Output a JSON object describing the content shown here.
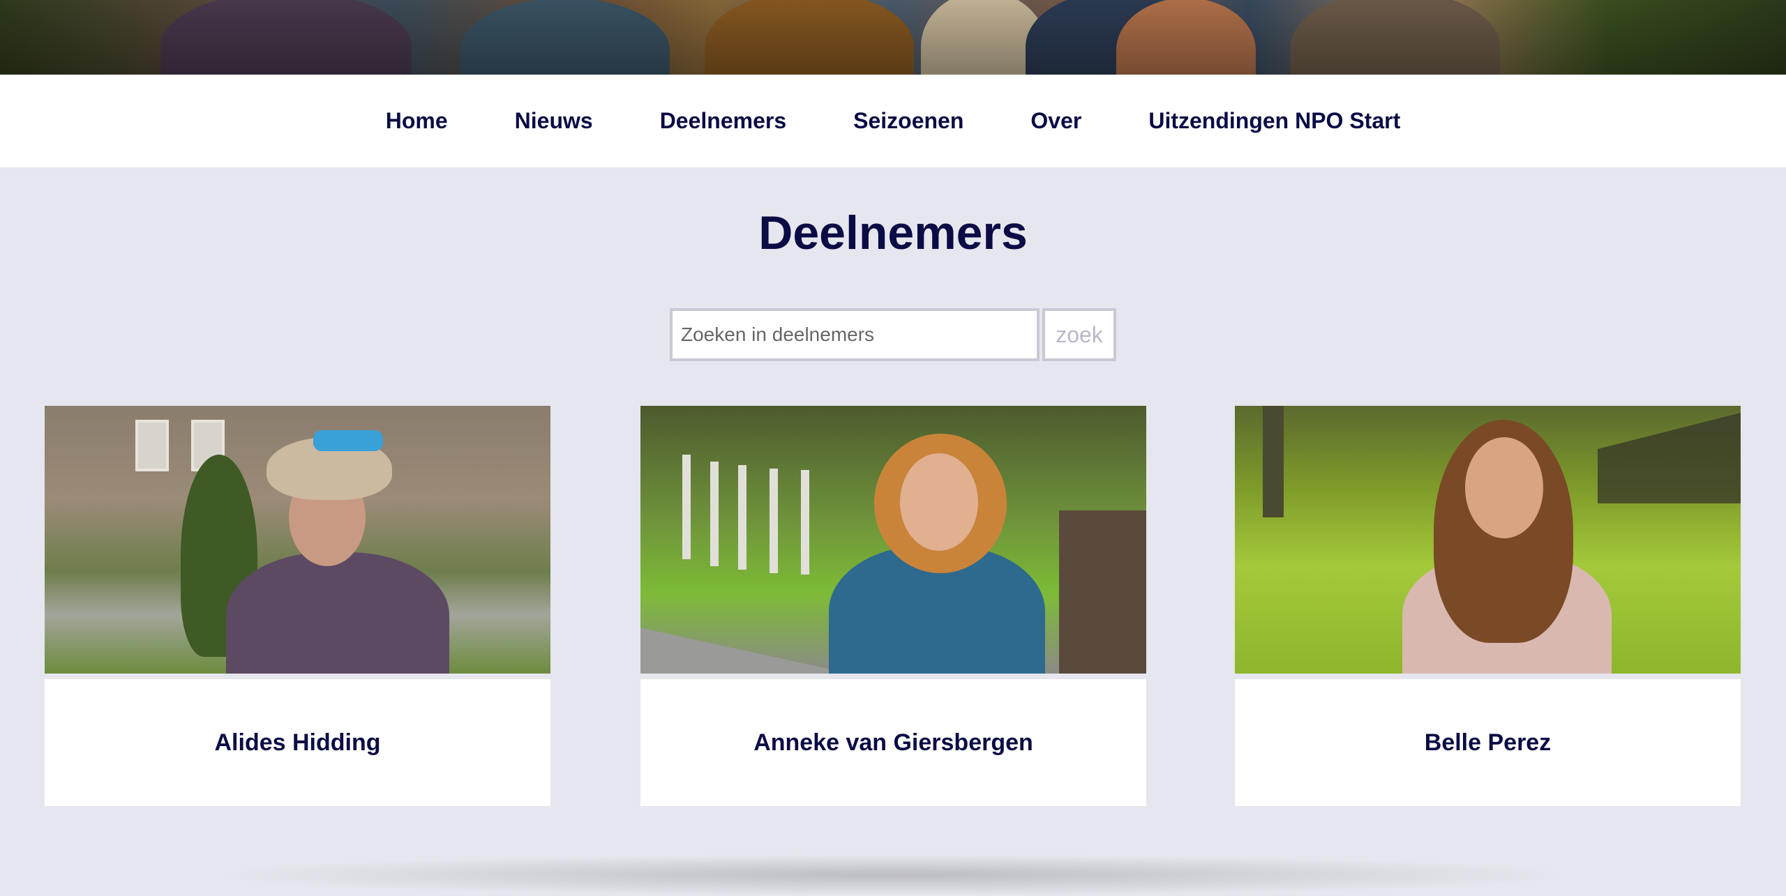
{
  "nav": {
    "items": [
      {
        "label": "Home"
      },
      {
        "label": "Nieuws"
      },
      {
        "label": "Deelnemers"
      },
      {
        "label": "Seizoenen"
      },
      {
        "label": "Over"
      },
      {
        "label": "Uitzendingen NPO Start"
      }
    ]
  },
  "page": {
    "title": "Deelnemers"
  },
  "search": {
    "placeholder": "Zoeken in deelnemers",
    "value": "",
    "button_label": "zoek"
  },
  "participants": [
    {
      "name": "Alides Hidding"
    },
    {
      "name": "Anneke van Giersbergen"
    },
    {
      "name": "Belle Perez"
    }
  ],
  "colors": {
    "primary_text": "#0b0b45",
    "page_background": "#e6e6ee",
    "nav_background": "#ffffff",
    "input_border": "#c9c9d6"
  }
}
